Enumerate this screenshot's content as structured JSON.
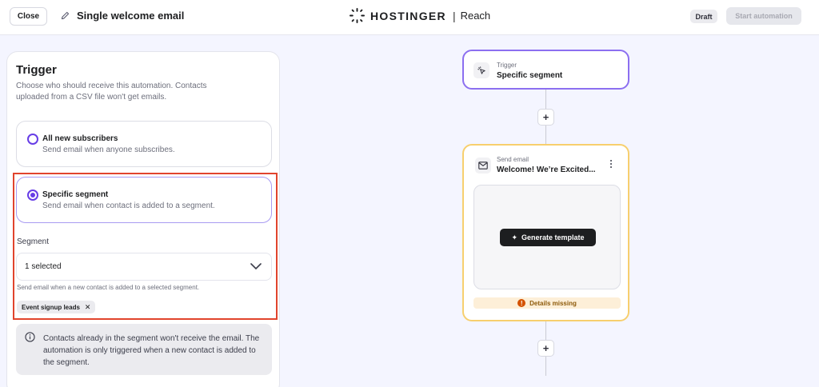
{
  "header": {
    "close_label": "Close",
    "automation_title": "Single welcome email",
    "brand_name": "HOSTINGER",
    "product_name": "Reach",
    "status_badge": "Draft",
    "start_label": "Start automation"
  },
  "trigger_panel": {
    "title": "Trigger",
    "description": "Choose who should receive this automation. Contacts uploaded from a CSV file won't get emails.",
    "options": [
      {
        "title": "All new subscribers",
        "subtitle": "Send email when anyone subscribes.",
        "selected": false
      },
      {
        "title": "Specific segment",
        "subtitle": "Send email when contact is added to a segment.",
        "selected": true
      }
    ],
    "segment": {
      "label": "Segment",
      "value": "1 selected",
      "help": "Send email when a new contact is added to a selected segment.",
      "tags": [
        "Event signup leads"
      ]
    },
    "info": "Contacts already in the segment won't receive the email. The automation is only triggered when a new contact is added to the segment."
  },
  "flow": {
    "trigger_node": {
      "caption": "Trigger",
      "title": "Specific segment"
    },
    "plus_label": "+",
    "email_node": {
      "caption": "Send email",
      "title": "Welcome! We’re Excited...",
      "generate_label": "Generate template",
      "warning": "Details missing"
    }
  },
  "colors": {
    "accent": "#673de6",
    "highlight_border": "#e1442d",
    "trigger_border": "#8c6ff0",
    "email_border": "#f7cf6e"
  }
}
